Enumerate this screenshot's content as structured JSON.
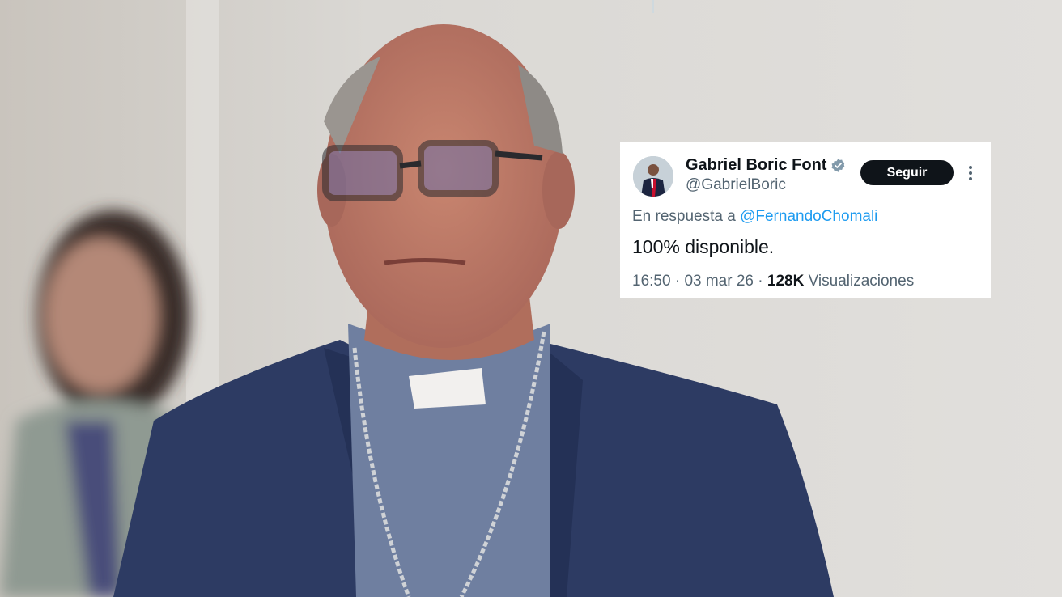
{
  "tweet": {
    "display_name": "Gabriel Boric Font",
    "verified": true,
    "handle": "@GabrielBoric",
    "follow_label": "Seguir",
    "reply_prefix": "En respuesta a",
    "reply_to": "@FernandoChomali",
    "text": "100% disponible.",
    "time": "16:50",
    "separator": "·",
    "date": "03 mar 26",
    "views_count": "128K",
    "views_label": "Visualizaciones"
  },
  "colors": {
    "text_primary": "#0f1419",
    "text_secondary": "#536471",
    "link": "#1d9bf0",
    "verified": "#829aab",
    "button_bg": "#0f1419"
  },
  "icons": {
    "verified": "verified-badge-icon",
    "more": "more-options-icon"
  }
}
